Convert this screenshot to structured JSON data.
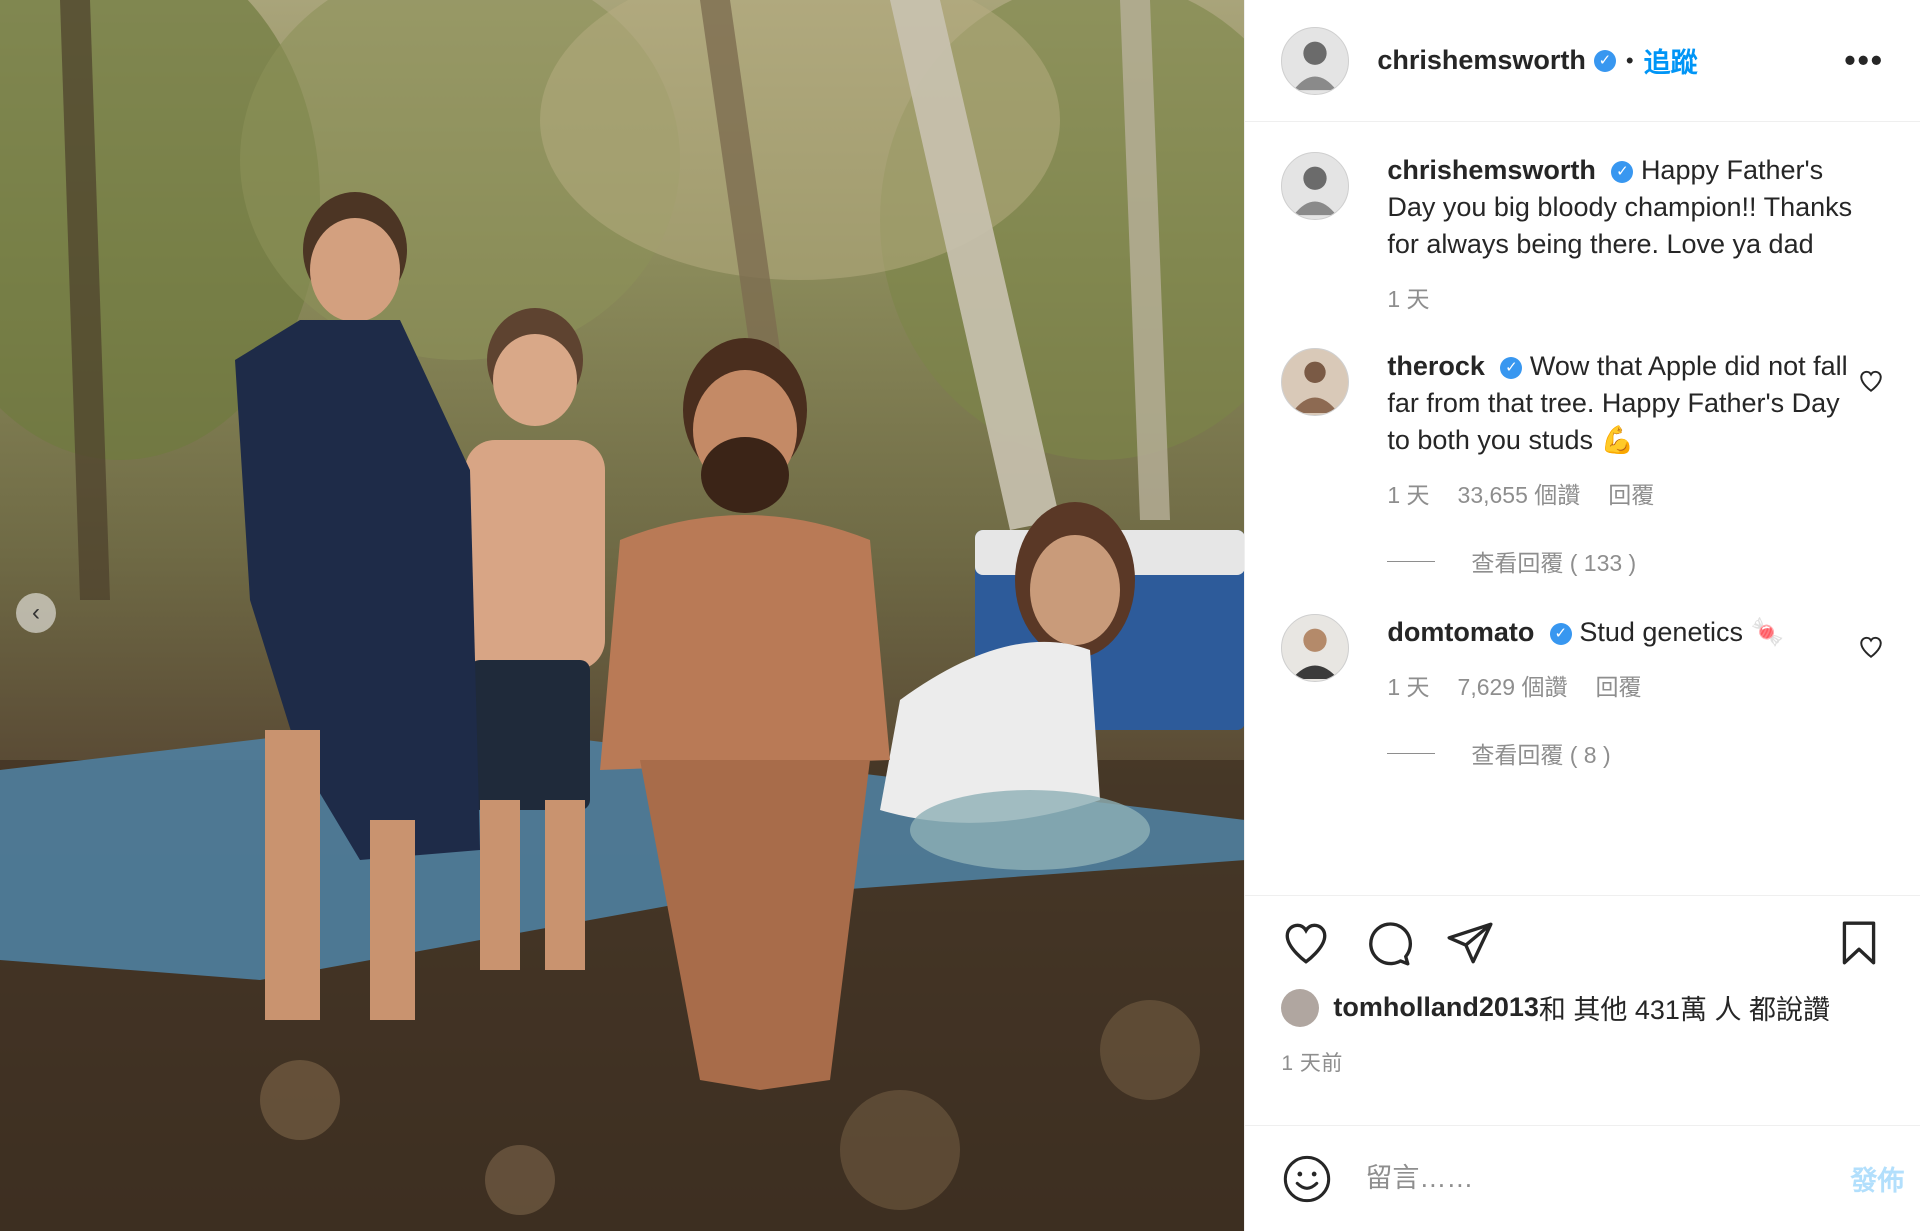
{
  "post": {
    "username": "chrishemsworth",
    "follow_label": "追蹤",
    "separator": "•",
    "more_label": "•••",
    "caption": "Happy Father's Day you big bloody champion!! Thanks for always being there. Love ya dad",
    "caption_age": "1 天"
  },
  "comments": [
    {
      "username": "therock",
      "text": "Wow that Apple did not fall far from that tree. Happy Father's Day to both you studs 💪",
      "age": "1 天",
      "likes": "33,655 個讚",
      "reply_label": "回覆",
      "view_replies": "查看回覆 ( 133 )"
    },
    {
      "username": "domtomato",
      "text": "Stud genetics 🍬",
      "age": "1 天",
      "likes": "7,629 個讚",
      "reply_label": "回覆",
      "view_replies": "查看回覆 ( 8 )"
    }
  ],
  "likes_line": {
    "user": "tomholland2013",
    "rest": " 和 其他 431萬 人 都說讚"
  },
  "timestamp": "1 天前",
  "composer": {
    "placeholder": "留言……",
    "post_label": "發佈"
  },
  "carousel": {
    "prev_glyph": "‹"
  },
  "verified_glyph": "✓"
}
